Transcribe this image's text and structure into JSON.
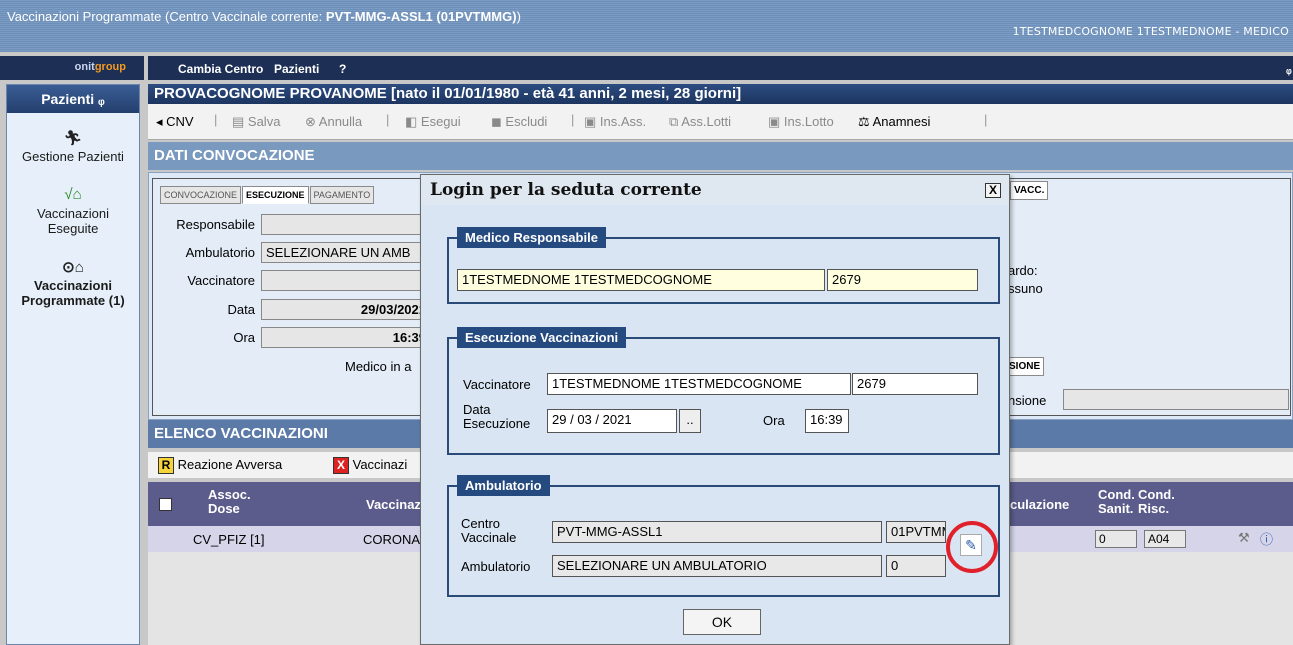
{
  "window": {
    "title_prefix": "Vaccinazioni Programmate (Centro Vaccinale corrente: ",
    "title_center": "PVT-MMG-ASSL1 (01PVTMMG)",
    "title_suffix": ")",
    "user": "1TESTMEDCOGNOME 1TESTMEDNOME - MEDICO"
  },
  "brand": {
    "part1": "onit",
    "part2": "group"
  },
  "menu": {
    "items": [
      "Cambia Centro",
      "Pazienti",
      "?"
    ]
  },
  "sidebar": {
    "header": "Pazienti",
    "pin": " ⱺ",
    "items": [
      {
        "label": "Gestione Pazienti",
        "icon": "runner-icon"
      },
      {
        "label": "Vaccinazioni Eseguite",
        "icon": "syringe-check-icon"
      },
      {
        "label": "Vaccinazioni Programmate (1)",
        "icon": "syringe-clock-icon"
      }
    ]
  },
  "patient": {
    "header": "PROVACOGNOME PROVANOME [nato il 01/01/1980 - età 41 anni, 2 mesi, 28 giorni]"
  },
  "toolbar": {
    "cnv": "CNV",
    "salva": "Salva",
    "annulla": "Annulla",
    "esegui": "Esegui",
    "escludi": "Escludi",
    "ins_ass": "Ins.Ass.",
    "ass_lotti": "Ass.Lotti",
    "ins_lotto": "Ins.Lotto",
    "anamnesi": "Anamnesi"
  },
  "dati_convocazione": {
    "title": "DATI CONVOCAZIONE",
    "tabs": [
      "CONVOCAZIONE",
      "ESECUZIONE",
      "PAGAMENTO"
    ],
    "right_tab": "VACC.",
    "right_tab2": "SIONE",
    "fields": {
      "responsabile_label": "Responsabile",
      "responsabile": "",
      "ambulatorio_label": "Ambulatorio",
      "ambulatorio": "SELEZIONARE UN AMB",
      "vaccinatore_label": "Vaccinatore",
      "vaccinatore": "",
      "data_label": "Data",
      "data": "29/03/2021",
      "ora_label": "Ora",
      "ora": "16:39",
      "medico_text": "Medico in a",
      "ritardo": "ardo:",
      "nessuno": "ssuno",
      "sospensione": "nsione"
    }
  },
  "elenco": {
    "title": "ELENCO VACCINAZIONI",
    "legend_r": "R",
    "legend_r_text": "Reazione Avversa",
    "legend_x": "X",
    "legend_x_text": "Vaccinazi",
    "headers": {
      "assoc": "Assoc.",
      "dose": "Dose",
      "vaccinaz": "Vaccinaz",
      "circolazione": "culazione",
      "cond_sanit_1": "Cond.",
      "cond_sanit_2": "Sanit.",
      "cond_risc_1": "Cond.",
      "cond_risc_2": "Risc."
    },
    "row": {
      "assoc": "CV_PFIZ [1]",
      "vacc": "CORONA",
      "cond_sanit": "0",
      "cond_risc": "A04"
    }
  },
  "dialog": {
    "title": "Login per la seduta corrente",
    "close": "X",
    "medico": {
      "legend": "Medico Responsabile",
      "nome": "1TESTMEDNOME 1TESTMEDCOGNOME",
      "codice": "2679"
    },
    "esecuzione": {
      "legend": "Esecuzione Vaccinazioni",
      "vaccinatore_label": "Vaccinatore",
      "vaccinatore": "1TESTMEDNOME 1TESTMEDCOGNOME",
      "vaccinatore_codice": "2679",
      "data_label_1": "Data",
      "data_label_2": "Esecuzione",
      "day": "29",
      "month": "03",
      "year": "2021",
      "picker": "..",
      "ora_label": "Ora",
      "ora": "16:39"
    },
    "ambulatorio": {
      "legend": "Ambulatorio",
      "centro_label_1": "Centro",
      "centro_label_2": "Vaccinale",
      "centro": "PVT-MMG-ASSL1",
      "centro_codice": "01PVTMM",
      "amb_label": "Ambulatorio",
      "amb": "SELEZIONARE UN AMBULATORIO",
      "amb_codice": "0"
    },
    "ok": "OK"
  },
  "colors": {
    "highlight_circle": "#e0202a",
    "header_dark": "#1d2f55",
    "legend_bg": "#254a80"
  }
}
